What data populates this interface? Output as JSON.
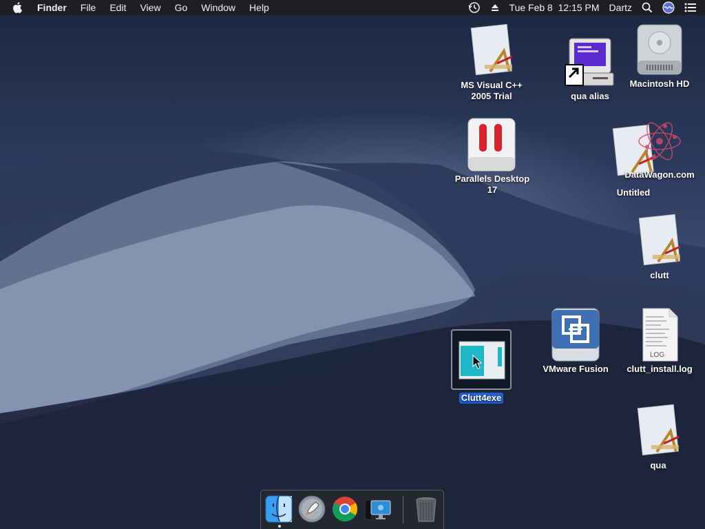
{
  "menubar": {
    "app_name": "Finder",
    "menus": [
      "File",
      "Edit",
      "View",
      "Go",
      "Window",
      "Help"
    ],
    "clock": "Tue Feb 8  12:15 PM",
    "user": "Dartz"
  },
  "desktop_icons": {
    "ms_visual": "MS Visual C++ 2005 Trial",
    "qua_alias": "qua alias",
    "macintosh_hd": "Macintosh HD",
    "parallels": "Parallels Desktop 17",
    "datawagon": "DataWagon.com",
    "untitled": "Untitled",
    "clutt": "clutt",
    "vmware": "VMware Fusion",
    "clutt_log": "clutt_install.log",
    "log_badge": "LOG",
    "clutt4exe": "Clutt4exe",
    "qua": "qua"
  },
  "dock": {
    "items": [
      "finder-icon",
      "launchpad-icon",
      "chrome-icon",
      "screen-sharing-icon",
      "trash-icon"
    ]
  },
  "colors": {
    "selection": "#1f5fd0",
    "menubar": "#1e1e22"
  }
}
